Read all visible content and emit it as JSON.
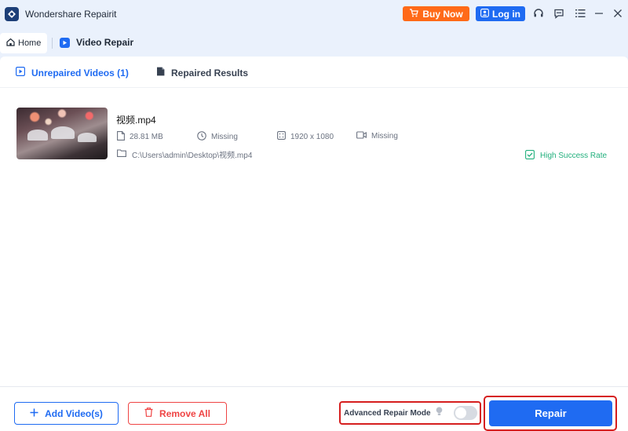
{
  "app": {
    "title": "Wondershare Repairit"
  },
  "titlebar": {
    "buy_now": "Buy Now",
    "log_in": "Log in",
    "icons": [
      "headset-icon",
      "chat-icon",
      "menu-icon",
      "minimize-icon",
      "close-icon"
    ]
  },
  "nav": {
    "home": "Home",
    "current": "Video Repair"
  },
  "tabs": [
    {
      "label": "Unrepaired Videos (1)",
      "active": true
    },
    {
      "label": "Repaired Results",
      "active": false
    }
  ],
  "video": {
    "name": "视频.mp4",
    "size": "28.81 MB",
    "duration": "Missing",
    "resolution": "1920 x 1080",
    "codec": "Missing",
    "path": "C:\\Users\\admin\\Desktop\\视频.mp4",
    "status": "High Success Rate"
  },
  "footer": {
    "add_videos": "Add Video(s)",
    "remove_all": "Remove All",
    "advanced_mode": "Advanced Repair Mode",
    "advanced_mode_on": false,
    "repair": "Repair"
  },
  "colors": {
    "accent": "#1f6bf2",
    "buy": "#ff6a18",
    "danger": "#ef4444",
    "success": "#22b07d"
  }
}
